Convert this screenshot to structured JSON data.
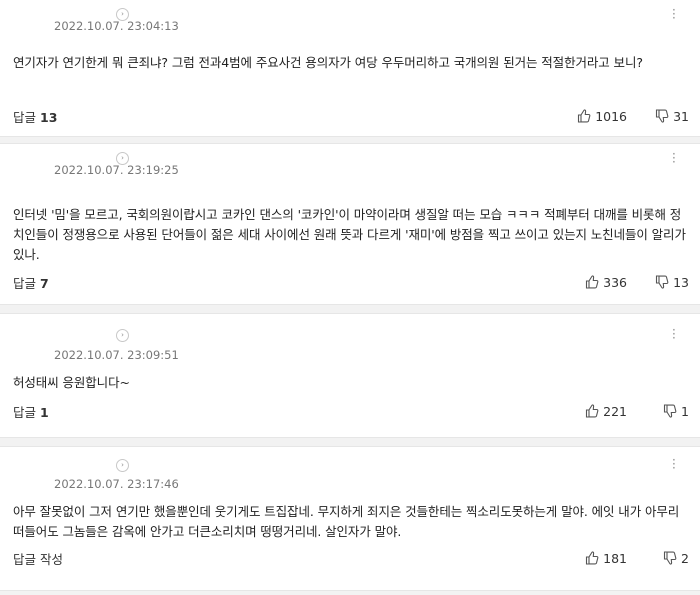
{
  "comments": [
    {
      "timestamp": "2022.10.07. 23:04:13",
      "text": "연기자가 연기한게 뭐 큰죄냐? 그럼 전과4범에 주요사건 용의자가 여당 우두머리하고 국개의원 된거는 적절한거라고 보니?",
      "reply_label": "답글",
      "reply_count": "13",
      "likes": "1016",
      "dislikes": "31"
    },
    {
      "timestamp": "2022.10.07. 23:19:25",
      "text": "인터넷 '밈'을 모르고, 국회의원이랍시고 코카인 댄스의 '코카인'이 마약이라며 생질알 떠는 모습 ㅋㅋㅋ 적폐부터 대깨를 비롯해 정치인들이 정쟁용으로 사용된 단어들이 젊은 세대 사이에선 원래 뜻과 다르게 '재미'에 방점을 찍고 쓰이고 있는지 노친네들이 알리가 있나.",
      "reply_label": "답글",
      "reply_count": "7",
      "likes": "336",
      "dislikes": "13"
    },
    {
      "timestamp": "2022.10.07. 23:09:51",
      "text": "허성태씨 응원합니다~",
      "reply_label": "답글",
      "reply_count": "1",
      "likes": "221",
      "dislikes": "1"
    },
    {
      "timestamp": "2022.10.07. 23:17:46",
      "text": "아무 잘못없이 그저 연기만 했을뿐인데 웃기게도 트집잡네. 무지하게 죄지은 것들한테는 찍소리도못하는게 말야. 에잇 내가 아무리 떠들어도 그놈들은 감옥에 안가고 더큰소리치며 떵떵거리네. 살인자가 말야.",
      "reply_label": "답글 작성",
      "reply_count": "",
      "likes": "181",
      "dislikes": "2"
    }
  ],
  "icons": {
    "profile_chevron": "chevron-right-icon",
    "more_menu": "more-vertical-icon",
    "like": "thumbs-up-icon",
    "dislike": "thumbs-down-icon"
  }
}
